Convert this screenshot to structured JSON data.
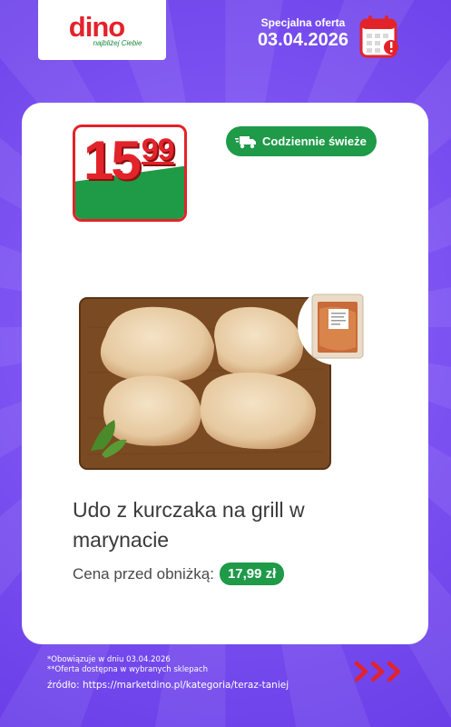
{
  "brand": {
    "name": "dino",
    "tagline": "najbliżej Ciebie",
    "red": "#e3232a",
    "green": "#1e9a48"
  },
  "header": {
    "offer_label": "Specjalna oferta",
    "offer_date": "03.04.2026",
    "calendar_icon": "calendar-alert-icon"
  },
  "product": {
    "price_main": "15",
    "price_cents": "99",
    "badge_label": "Codziennie świeże",
    "badge_icon": "delivery-truck-icon",
    "title": "Udo z kurczaka na grill w marynacie",
    "previous_price_label": "Cena przed obniżką:",
    "previous_price": "17,99 zł"
  },
  "footer": {
    "note1": "*Obowiązuje w dniu 03.04.2026",
    "note2": "**Oferta dostępna w wybranych sklepach",
    "source": "źródło: https://marketdino.pl/kategoria/teraz-taniej",
    "arrows_icon": "triple-chevron-right-icon"
  }
}
